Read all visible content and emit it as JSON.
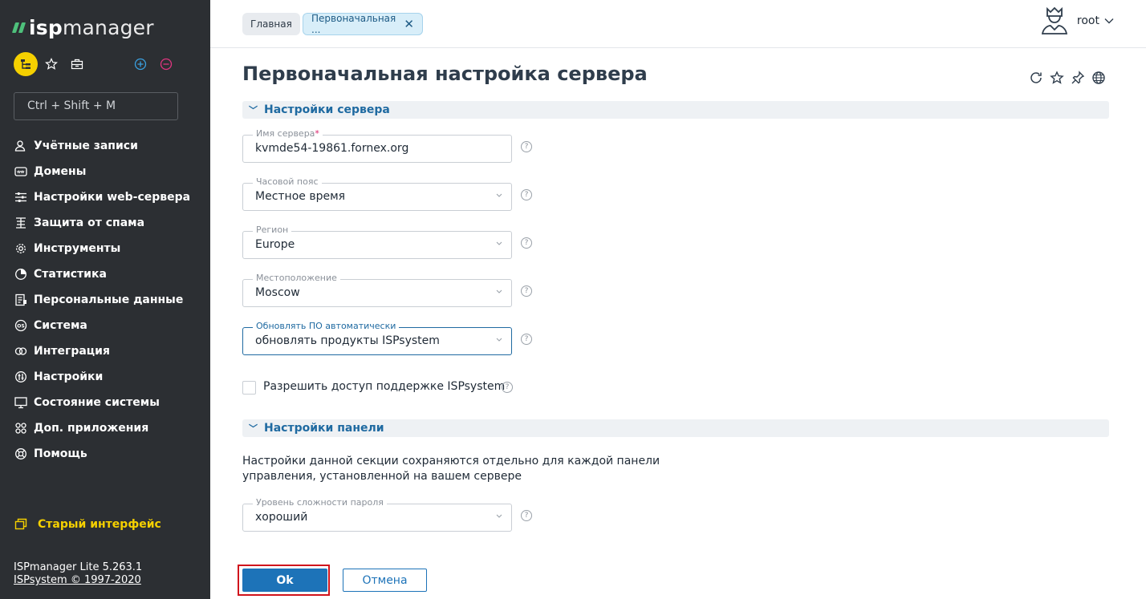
{
  "app": {
    "logo_isp": "isp",
    "logo_manager": "manager",
    "search_placeholder": "Ctrl + Shift + M"
  },
  "sidebar": {
    "items": [
      {
        "label": "Учётные записи",
        "icon": "users-icon"
      },
      {
        "label": "Домены",
        "icon": "www-icon"
      },
      {
        "label": "Настройки web-сервера",
        "icon": "sliders-icon"
      },
      {
        "label": "Защита от спама",
        "icon": "spam-shield-icon"
      },
      {
        "label": "Инструменты",
        "icon": "gear-icon"
      },
      {
        "label": "Статистика",
        "icon": "pie-chart-icon"
      },
      {
        "label": "Персональные данные",
        "icon": "personal-data-icon"
      },
      {
        "label": "Система",
        "icon": "os-icon"
      },
      {
        "label": "Интеграция",
        "icon": "integration-icon"
      },
      {
        "label": "Настройки",
        "icon": "settings-icon"
      },
      {
        "label": "Состояние системы",
        "icon": "monitor-icon"
      },
      {
        "label": "Доп. приложения",
        "icon": "apps-icon"
      },
      {
        "label": "Помощь",
        "icon": "help-buoy-icon"
      }
    ],
    "old_interface": "Старый интерфейс",
    "version": "ISPmanager Lite 5.263.1",
    "copyright": "ISPsystem © 1997-2020"
  },
  "header": {
    "crumb_home": "Главная",
    "crumb_active": "Первоначальная ...",
    "user": "root"
  },
  "main": {
    "title": "Первоначальная настройка сервера",
    "section_server": "Настройки сервера",
    "fields": {
      "server_name_label": "Имя сервера",
      "server_name_value": "kvmde54-19861.fornex.org",
      "timezone_label": "Часовой пояс",
      "timezone_value": "Местное время",
      "region_label": "Регион",
      "region_value": "Europe",
      "location_label": "Местоположение",
      "location_value": "Moscow",
      "autoupdate_label": "Обновлять ПО автоматически",
      "autoupdate_value": "обновлять продукты ISPsystem"
    },
    "support_access_label": "Разрешить доступ поддержке ISPsystem",
    "section_panel": "Настройки панели",
    "panel_note": "Настройки данной секции сохраняются отдельно для каждой панели управления, установленной на вашем сервере",
    "password_level_label": "Уровень сложности пароля",
    "password_level_value": "хороший",
    "ok": "Ok",
    "cancel": "Отмена"
  },
  "colors": {
    "sidebar_bg": "#2c2f33",
    "accent_blue": "#1d73b8",
    "accent_yellow": "#f5d000",
    "logo_green": "#4ec07b",
    "highlight_red": "#d0141c"
  }
}
